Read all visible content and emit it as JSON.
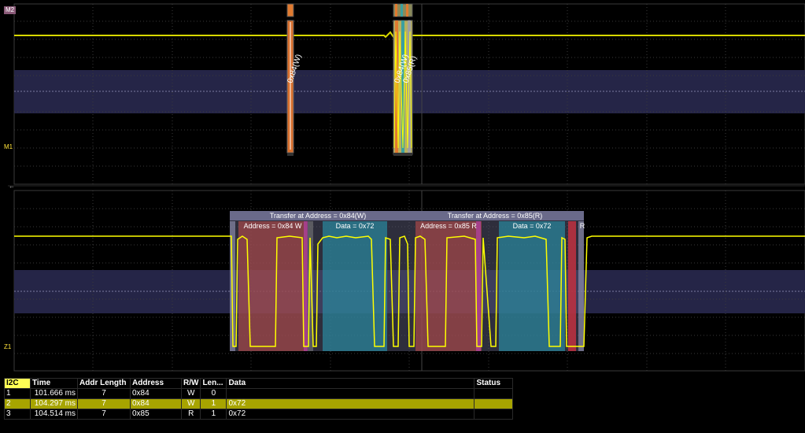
{
  "colors": {
    "trace": "#ffff00",
    "grid": "#2c2c2c",
    "band": "#252547",
    "address": "#d05050",
    "data": "#2aa0b0",
    "selected_row": "#a7a400"
  },
  "top_panel": {
    "label_top": "M2",
    "label_bottom": "M1",
    "annotations": [
      {
        "text": "0x84(W)"
      },
      {
        "text": "0x84(W)"
      },
      {
        "text": "0x85(R)"
      }
    ]
  },
  "bottom_panel": {
    "label": "Z1",
    "packets": [
      {
        "transfer": "Transfer at Address = 0x84(W)",
        "address": "Address = 0x84 W",
        "data": "Data = 0x72"
      },
      {
        "transfer": "Transfer at Address = 0x85(R)",
        "address": "Address = 0x85 R",
        "data": "Data = 0x72",
        "tail": "R"
      }
    ]
  },
  "decode_table": {
    "headers": [
      "I2C",
      "Time",
      "Addr Length",
      "Address",
      "R/W",
      "Len...",
      "Data",
      "Status"
    ],
    "rows": [
      {
        "index": "1",
        "time": "101.666 ms",
        "addr_length": "7",
        "address": "0x84",
        "rw": "W",
        "len": "0",
        "data": "",
        "status": ""
      },
      {
        "index": "2",
        "time": "104.297 ms",
        "addr_length": "7",
        "address": "0x84",
        "rw": "W",
        "len": "1",
        "data": "0x72",
        "status": ""
      },
      {
        "index": "3",
        "time": "104.514 ms",
        "addr_length": "7",
        "address": "0x85",
        "rw": "R",
        "len": "1",
        "data": "0x72",
        "status": ""
      }
    ]
  }
}
